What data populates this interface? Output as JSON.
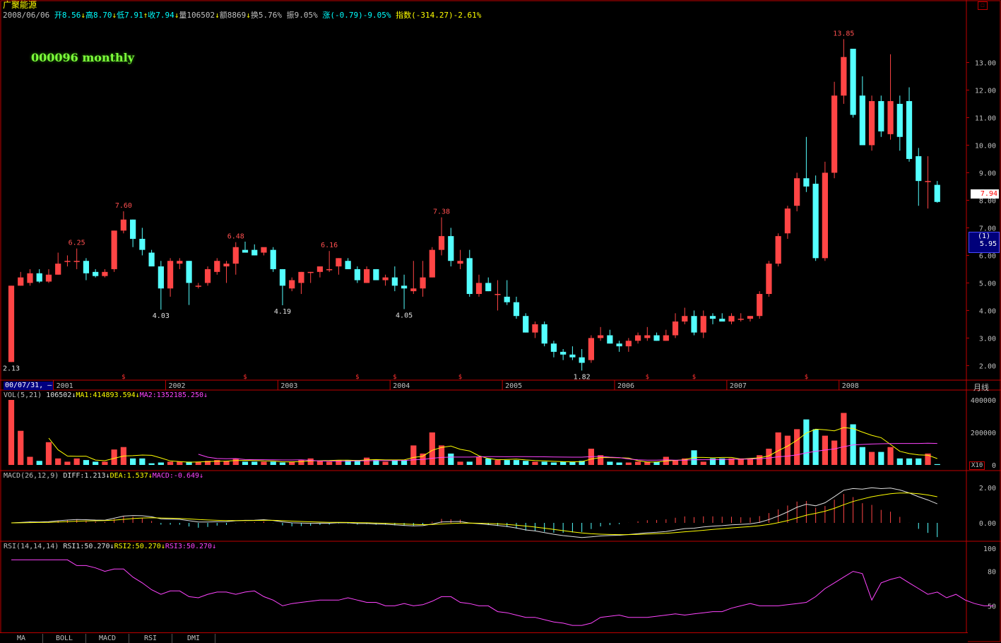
{
  "header": {
    "stock_name": "广聚能源",
    "date": "2008/06/06",
    "open": "开8.56",
    "high": "高8.70",
    "low": "低7.91",
    "close": "收7.94",
    "volume": "量106502",
    "amount": "额8869",
    "turnover": "换5.76%",
    "amplitude": "振9.05%",
    "change": "涨(-0.79)-9.05%",
    "index_label": "指数",
    "index_change": "(-314.27)-2.61%",
    "overlay_label": "000096 monthly",
    "current_price": "7.94",
    "box_top": "(1)",
    "box_price": "5.95",
    "period_label": "月线",
    "cursor_date": "00/07/31,",
    "x10": "X10"
  },
  "colors": {
    "up": "#ff4545",
    "down": "#54ffff",
    "grid": "#c00000",
    "ma_yellow": "#ffff00",
    "ma_magenta": "#ff44ff",
    "white": "#e0e0e0"
  },
  "indicators": {
    "vol": {
      "name": "VOL(5,21)",
      "value": "106502",
      "ma1": "MA1:414893.594",
      "ma2": "MA2:1352185.250"
    },
    "macd": {
      "name": "MACD(26,12,9)",
      "diff": "DIFF:1.213",
      "dea": "DEA:1.537",
      "macd": "MACD:-0.649"
    },
    "rsi": {
      "name": "RSI(14,14,14)",
      "rsi1": "RSI1:50.270",
      "rsi2": "RSI2:50.270",
      "rsi3": "RSI3:50.270"
    }
  },
  "tabs": [
    "MA",
    "BOLL",
    "MACD",
    "RSI",
    "DMI"
  ],
  "chart_data": {
    "type": "candlestick",
    "title": "000096 monthly",
    "price_ylim": [
      1.6,
      14.5
    ],
    "price_ticks": [
      "2.00",
      "3.00",
      "4.00",
      "5.00",
      "6.00",
      "7.00",
      "8.00",
      "9.00",
      "10.00",
      "11.00",
      "12.00",
      "13.00"
    ],
    "years": [
      "2001",
      "2002",
      "2003",
      "2004",
      "2005",
      "2006",
      "2007",
      "2008"
    ],
    "year_start_index": [
      5,
      17,
      29,
      41,
      53,
      65,
      77,
      89
    ],
    "candles": [
      [
        2.13,
        4.9,
        2.13,
        4.9
      ],
      [
        4.9,
        5.4,
        4.9,
        5.2
      ],
      [
        5.0,
        5.5,
        4.9,
        5.35
      ],
      [
        5.35,
        5.5,
        5.0,
        5.05
      ],
      [
        5.05,
        5.5,
        5.0,
        5.3
      ],
      [
        5.3,
        6.1,
        5.3,
        5.7
      ],
      [
        5.8,
        6.0,
        5.6,
        5.8
      ],
      [
        5.8,
        6.25,
        5.5,
        5.8
      ],
      [
        5.8,
        5.9,
        5.1,
        5.35
      ],
      [
        5.4,
        5.5,
        5.2,
        5.25
      ],
      [
        5.25,
        5.5,
        5.2,
        5.4
      ],
      [
        5.5,
        6.9,
        5.4,
        6.9
      ],
      [
        6.9,
        7.6,
        6.8,
        7.3
      ],
      [
        7.3,
        7.3,
        6.3,
        6.6
      ],
      [
        6.6,
        7.0,
        6.0,
        6.2
      ],
      [
        6.1,
        6.2,
        5.6,
        5.6
      ],
      [
        5.6,
        5.8,
        4.03,
        4.8
      ],
      [
        4.8,
        5.9,
        4.5,
        5.8
      ],
      [
        5.7,
        5.9,
        5.5,
        5.8
      ],
      [
        5.8,
        5.8,
        4.2,
        5.0
      ],
      [
        4.9,
        5.0,
        4.8,
        4.9
      ],
      [
        5.0,
        5.6,
        4.9,
        5.5
      ],
      [
        5.4,
        5.9,
        5.3,
        5.8
      ],
      [
        5.6,
        5.8,
        5.0,
        5.7
      ],
      [
        5.7,
        6.48,
        5.3,
        6.3
      ],
      [
        6.2,
        6.5,
        6.2,
        6.1
      ],
      [
        6.2,
        6.4,
        6.0,
        6.0
      ],
      [
        6.1,
        6.2,
        6.0,
        6.3
      ],
      [
        6.2,
        6.3,
        5.4,
        5.5
      ],
      [
        5.5,
        5.5,
        4.19,
        4.9
      ],
      [
        4.8,
        5.2,
        4.7,
        5.1
      ],
      [
        5.0,
        5.4,
        4.6,
        5.4
      ],
      [
        5.4,
        5.4,
        5.0,
        5.4
      ],
      [
        5.4,
        5.6,
        5.2,
        5.6
      ],
      [
        5.5,
        6.16,
        5.4,
        5.5
      ],
      [
        5.6,
        5.9,
        5.3,
        5.9
      ],
      [
        5.8,
        5.9,
        5.5,
        5.5
      ],
      [
        5.5,
        5.6,
        5.0,
        5.1
      ],
      [
        5.0,
        5.6,
        5.0,
        5.5
      ],
      [
        5.5,
        5.5,
        5.1,
        5.1
      ],
      [
        5.1,
        5.3,
        4.9,
        5.2
      ],
      [
        5.2,
        5.6,
        4.7,
        4.9
      ],
      [
        4.9,
        5.3,
        4.05,
        4.8
      ],
      [
        4.7,
        5.8,
        4.6,
        4.8
      ],
      [
        4.8,
        5.8,
        4.5,
        5.2
      ],
      [
        5.2,
        6.3,
        5.2,
        6.2
      ],
      [
        6.2,
        7.38,
        6.0,
        6.7
      ],
      [
        6.7,
        7.0,
        5.6,
        5.8
      ],
      [
        5.7,
        6.2,
        5.5,
        5.8
      ],
      [
        5.9,
        6.2,
        4.5,
        4.6
      ],
      [
        4.6,
        5.3,
        4.5,
        5.0
      ],
      [
        5.0,
        5.2,
        4.7,
        4.7
      ],
      [
        4.6,
        5.1,
        4.0,
        4.6
      ],
      [
        4.5,
        5.1,
        4.2,
        4.3
      ],
      [
        4.3,
        4.5,
        3.7,
        3.8
      ],
      [
        3.8,
        3.9,
        3.2,
        3.2
      ],
      [
        3.2,
        3.6,
        3.0,
        3.5
      ],
      [
        3.5,
        3.6,
        2.7,
        2.8
      ],
      [
        2.8,
        2.9,
        2.3,
        2.5
      ],
      [
        2.5,
        2.6,
        2.2,
        2.4
      ],
      [
        2.4,
        2.7,
        2.2,
        2.3
      ],
      [
        2.3,
        2.6,
        1.82,
        2.1
      ],
      [
        2.2,
        3.1,
        2.1,
        3.0
      ],
      [
        3.0,
        3.4,
        2.9,
        3.1
      ],
      [
        3.1,
        3.3,
        2.8,
        2.8
      ],
      [
        2.8,
        2.9,
        2.5,
        2.7
      ],
      [
        2.7,
        3.0,
        2.5,
        2.9
      ],
      [
        2.9,
        3.2,
        2.8,
        3.1
      ],
      [
        3.0,
        3.4,
        2.9,
        3.1
      ],
      [
        3.1,
        3.2,
        2.9,
        2.9
      ],
      [
        2.9,
        3.3,
        2.9,
        3.1
      ],
      [
        3.1,
        3.9,
        3.0,
        3.6
      ],
      [
        3.6,
        4.1,
        3.5,
        3.8
      ],
      [
        3.8,
        4.0,
        3.1,
        3.2
      ],
      [
        3.2,
        4.0,
        3.0,
        3.8
      ],
      [
        3.8,
        3.9,
        3.5,
        3.7
      ],
      [
        3.7,
        3.9,
        3.6,
        3.6
      ],
      [
        3.6,
        3.9,
        3.5,
        3.8
      ],
      [
        3.7,
        3.9,
        3.6,
        3.7
      ],
      [
        3.7,
        3.8,
        3.6,
        3.8
      ],
      [
        3.8,
        4.7,
        3.7,
        4.6
      ],
      [
        4.6,
        5.8,
        4.5,
        5.7
      ],
      [
        5.7,
        6.8,
        5.6,
        6.7
      ],
      [
        6.8,
        7.8,
        6.6,
        7.7
      ],
      [
        7.8,
        9.0,
        7.6,
        8.8
      ],
      [
        8.8,
        10.3,
        8.3,
        8.5
      ],
      [
        8.6,
        8.9,
        5.8,
        5.9
      ],
      [
        5.9,
        9.4,
        5.8,
        9.0
      ],
      [
        9.0,
        12.3,
        8.8,
        11.8
      ],
      [
        11.8,
        13.85,
        11.5,
        13.2
      ],
      [
        13.5,
        13.5,
        11.0,
        11.1
      ],
      [
        11.8,
        12.5,
        10.0,
        10.0
      ],
      [
        10.0,
        11.8,
        9.8,
        11.6
      ],
      [
        11.6,
        11.8,
        10.3,
        10.5
      ],
      [
        10.4,
        13.3,
        10.2,
        11.6
      ],
      [
        11.5,
        11.8,
        9.8,
        10.3
      ],
      [
        11.6,
        12.1,
        9.4,
        9.5
      ],
      [
        9.6,
        9.9,
        7.8,
        8.7
      ],
      [
        8.7,
        9.6,
        7.7,
        8.7
      ],
      [
        8.56,
        8.7,
        7.91,
        7.94
      ]
    ],
    "price_labels": [
      {
        "i": 0,
        "value": "2.13",
        "pos": "low"
      },
      {
        "i": 7,
        "value": "6.25",
        "pos": "high"
      },
      {
        "i": 12,
        "value": "7.60",
        "pos": "high"
      },
      {
        "i": 16,
        "value": "4.03",
        "pos": "low"
      },
      {
        "i": 24,
        "value": "6.48",
        "pos": "high"
      },
      {
        "i": 29,
        "value": "4.19",
        "pos": "low"
      },
      {
        "i": 34,
        "value": "6.16",
        "pos": "high"
      },
      {
        "i": 42,
        "value": "4.05",
        "pos": "low"
      },
      {
        "i": 46,
        "value": "7.38",
        "pos": "high"
      },
      {
        "i": 61,
        "value": "1.82",
        "pos": "low"
      },
      {
        "i": 89,
        "value": "13.85",
        "pos": "high"
      }
    ],
    "dividend_marks_index": [
      12,
      25,
      37,
      41,
      48,
      68,
      73,
      85
    ],
    "dividend_mark": "$",
    "volume_ylim": [
      0,
      400000
    ],
    "volume_ticks": [
      "0",
      "200000",
      "400000"
    ],
    "volume_x10": [
      400000,
      210000,
      50000,
      25000,
      140000,
      40000,
      20000,
      40000,
      30000,
      20000,
      20000,
      95000,
      110000,
      40000,
      40000,
      10000,
      15000,
      20000,
      20000,
      20000,
      18000,
      25000,
      30000,
      25000,
      40000,
      20000,
      20000,
      20000,
      20000,
      15000,
      20000,
      30000,
      40000,
      25000,
      20000,
      30000,
      30000,
      30000,
      45000,
      30000,
      20000,
      30000,
      30000,
      120000,
      70000,
      200000,
      120000,
      70000,
      20000,
      20000,
      50000,
      40000,
      30000,
      30000,
      30000,
      25000,
      20000,
      20000,
      15000,
      20000,
      20000,
      25000,
      100000,
      60000,
      20000,
      15000,
      15000,
      20000,
      20000,
      20000,
      50000,
      30000,
      40000,
      90000,
      20000,
      40000,
      40000,
      40000,
      40000,
      40000,
      60000,
      100000,
      200000,
      180000,
      220000,
      280000,
      220000,
      180000,
      150000,
      320000,
      250000,
      110000,
      80000,
      80000,
      110000,
      40000,
      40000,
      40000,
      70000,
      5000
    ],
    "macd_ylim": [
      -0.8,
      2.4
    ],
    "macd_ticks": [
      "0.00",
      "2.00"
    ],
    "rsi_ylim": [
      30,
      100
    ],
    "rsi_ticks": [
      "50",
      "80",
      "100"
    ],
    "rsi_values": [
      90,
      90,
      90,
      90,
      90,
      90,
      90,
      85,
      85,
      83,
      80,
      82,
      82,
      75,
      70,
      64,
      60,
      63,
      63,
      58,
      57,
      60,
      62,
      62,
      60,
      62,
      63,
      58,
      55,
      50,
      52,
      53,
      54,
      55,
      55,
      55,
      57,
      55,
      53,
      53,
      50,
      50,
      52,
      50,
      51,
      54,
      58,
      58,
      53,
      52,
      50,
      50,
      45,
      44,
      42,
      40,
      40,
      38,
      36,
      35,
      33,
      33,
      35,
      40,
      41,
      42,
      40,
      40,
      40,
      41,
      42,
      43,
      42,
      43,
      44,
      45,
      45,
      48,
      50,
      52,
      50,
      50,
      50,
      51,
      52,
      53,
      58,
      65,
      70,
      75,
      80,
      78,
      55,
      70,
      73,
      75,
      70,
      65,
      60,
      62,
      57,
      60,
      55,
      52,
      50,
      50
    ]
  }
}
